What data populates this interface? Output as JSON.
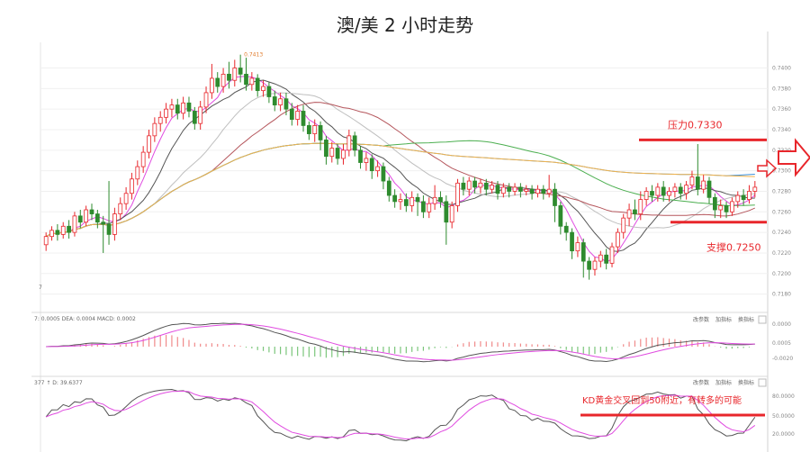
{
  "chart_data": {
    "type": "candlestick",
    "title": "澳/美 2 小时走势",
    "main": {
      "ylim": [
        0.717,
        0.7425
      ],
      "ticks": [
        "0.7400",
        "0.7380",
        "0.7360",
        "0.7340",
        "0.7320",
        "0.7300",
        "0.7280",
        "0.7260",
        "0.7240",
        "0.7220",
        "0.7200",
        "0.7180"
      ],
      "high_label": "0.7413",
      "left_label": "7",
      "candles": [
        [
          0.7228,
          0.7236,
          0.7222,
          0.724
        ],
        [
          0.7236,
          0.7242,
          0.7232,
          0.7246
        ],
        [
          0.7242,
          0.7238,
          0.7232,
          0.7248
        ],
        [
          0.7238,
          0.7246,
          0.7234,
          0.725
        ],
        [
          0.7246,
          0.724,
          0.7234,
          0.7252
        ],
        [
          0.724,
          0.7256,
          0.7236,
          0.726
        ],
        [
          0.7256,
          0.725,
          0.7244,
          0.7262
        ],
        [
          0.725,
          0.7262,
          0.7246,
          0.7266
        ],
        [
          0.7262,
          0.7258,
          0.7252,
          0.7268
        ],
        [
          0.7258,
          0.725,
          0.7244,
          0.7262
        ],
        [
          0.725,
          0.7248,
          0.722,
          0.7256
        ],
        [
          0.7248,
          0.7238,
          0.7228,
          0.729
        ],
        [
          0.7238,
          0.7258,
          0.7232,
          0.7264
        ],
        [
          0.7258,
          0.7268,
          0.7252,
          0.7274
        ],
        [
          0.7268,
          0.7278,
          0.7262,
          0.7284
        ],
        [
          0.7278,
          0.7292,
          0.7272,
          0.7298
        ],
        [
          0.7292,
          0.7304,
          0.7286,
          0.731
        ],
        [
          0.7304,
          0.7318,
          0.7298,
          0.7324
        ],
        [
          0.7318,
          0.7334,
          0.7312,
          0.734
        ],
        [
          0.7334,
          0.7346,
          0.7328,
          0.7352
        ],
        [
          0.7346,
          0.7352,
          0.7338,
          0.7358
        ],
        [
          0.7352,
          0.736,
          0.7346,
          0.7366
        ],
        [
          0.736,
          0.7364,
          0.7352,
          0.737
        ],
        [
          0.7364,
          0.7356,
          0.735,
          0.737
        ],
        [
          0.7356,
          0.7366,
          0.735,
          0.7372
        ],
        [
          0.7366,
          0.7358,
          0.7352,
          0.7372
        ],
        [
          0.7358,
          0.7346,
          0.734,
          0.7362
        ],
        [
          0.7346,
          0.7362,
          0.734,
          0.7368
        ],
        [
          0.7362,
          0.7376,
          0.7356,
          0.7382
        ],
        [
          0.7376,
          0.739,
          0.737,
          0.7404
        ],
        [
          0.739,
          0.7382,
          0.7376,
          0.7396
        ],
        [
          0.7382,
          0.7394,
          0.7376,
          0.74
        ],
        [
          0.7394,
          0.7388,
          0.738,
          0.7406
        ],
        [
          0.7388,
          0.74,
          0.7382,
          0.7408
        ],
        [
          0.74,
          0.7394,
          0.7386,
          0.7413
        ],
        [
          0.7394,
          0.7384,
          0.7378,
          0.741
        ],
        [
          0.7384,
          0.739,
          0.7378,
          0.7396
        ],
        [
          0.739,
          0.7378,
          0.7372,
          0.7394
        ],
        [
          0.7378,
          0.7382,
          0.7372,
          0.7388
        ],
        [
          0.7382,
          0.7372,
          0.7366,
          0.7386
        ],
        [
          0.7372,
          0.7364,
          0.7358,
          0.7378
        ],
        [
          0.7364,
          0.737,
          0.7358,
          0.7376
        ],
        [
          0.737,
          0.736,
          0.7354,
          0.7376
        ],
        [
          0.736,
          0.735,
          0.7344,
          0.7366
        ],
        [
          0.735,
          0.7358,
          0.7344,
          0.7364
        ],
        [
          0.7358,
          0.7344,
          0.7338,
          0.7364
        ],
        [
          0.7344,
          0.7336,
          0.733,
          0.7348
        ],
        [
          0.7336,
          0.7344,
          0.7328,
          0.735
        ],
        [
          0.7344,
          0.733,
          0.732,
          0.7348
        ],
        [
          0.733,
          0.7314,
          0.7306,
          0.7334
        ],
        [
          0.7314,
          0.7322,
          0.7308,
          0.7328
        ],
        [
          0.7322,
          0.7312,
          0.7306,
          0.7326
        ],
        [
          0.7312,
          0.732,
          0.7306,
          0.7326
        ],
        [
          0.732,
          0.7334,
          0.7314,
          0.734
        ],
        [
          0.7334,
          0.732,
          0.7314,
          0.7338
        ],
        [
          0.732,
          0.7308,
          0.7302,
          0.7324
        ],
        [
          0.7308,
          0.7312,
          0.73,
          0.7318
        ],
        [
          0.7312,
          0.73,
          0.7292,
          0.7316
        ],
        [
          0.73,
          0.7304,
          0.7294,
          0.731
        ],
        [
          0.7304,
          0.729,
          0.7282,
          0.7308
        ],
        [
          0.729,
          0.7276,
          0.727,
          0.7294
        ],
        [
          0.7276,
          0.727,
          0.7264,
          0.7282
        ],
        [
          0.727,
          0.7272,
          0.7262,
          0.7278
        ],
        [
          0.7272,
          0.7266,
          0.726,
          0.7278
        ],
        [
          0.7266,
          0.7274,
          0.726,
          0.728
        ],
        [
          0.7274,
          0.727,
          0.7256,
          0.7278
        ],
        [
          0.727,
          0.726,
          0.7254,
          0.7276
        ],
        [
          0.726,
          0.7268,
          0.7254,
          0.7274
        ],
        [
          0.7268,
          0.7274,
          0.7262,
          0.7286
        ],
        [
          0.7274,
          0.727,
          0.7264,
          0.728
        ],
        [
          0.727,
          0.725,
          0.7228,
          0.7276
        ],
        [
          0.725,
          0.7266,
          0.7244,
          0.727
        ],
        [
          0.7266,
          0.7288,
          0.726,
          0.7292
        ],
        [
          0.7288,
          0.7282,
          0.7276,
          0.7294
        ],
        [
          0.7282,
          0.729,
          0.7276,
          0.7294
        ],
        [
          0.729,
          0.7284,
          0.7278,
          0.7294
        ],
        [
          0.7284,
          0.7288,
          0.7278,
          0.7292
        ],
        [
          0.7288,
          0.7282,
          0.7276,
          0.7292
        ],
        [
          0.7282,
          0.7286,
          0.7278,
          0.729
        ],
        [
          0.7286,
          0.7278,
          0.7272,
          0.729
        ],
        [
          0.7278,
          0.7284,
          0.7274,
          0.7288
        ],
        [
          0.7284,
          0.728,
          0.7274,
          0.7288
        ],
        [
          0.728,
          0.7284,
          0.7276,
          0.7288
        ],
        [
          0.7284,
          0.728,
          0.7274,
          0.7288
        ],
        [
          0.728,
          0.7282,
          0.7276,
          0.7286
        ],
        [
          0.7282,
          0.7278,
          0.7272,
          0.7286
        ],
        [
          0.7278,
          0.7282,
          0.7274,
          0.7286
        ],
        [
          0.7282,
          0.7278,
          0.7272,
          0.7286
        ],
        [
          0.7278,
          0.7282,
          0.7274,
          0.7296
        ],
        [
          0.7282,
          0.7266,
          0.725,
          0.7288
        ],
        [
          0.7266,
          0.7246,
          0.7238,
          0.727
        ],
        [
          0.7246,
          0.724,
          0.7232,
          0.725
        ],
        [
          0.724,
          0.7222,
          0.7214,
          0.7244
        ],
        [
          0.7222,
          0.723,
          0.7216,
          0.7236
        ],
        [
          0.723,
          0.7212,
          0.7196,
          0.7234
        ],
        [
          0.7212,
          0.7204,
          0.7194,
          0.7216
        ],
        [
          0.7204,
          0.7212,
          0.7198,
          0.7216
        ],
        [
          0.7212,
          0.7218,
          0.7206,
          0.7222
        ],
        [
          0.7218,
          0.721,
          0.7204,
          0.7224
        ],
        [
          0.721,
          0.7226,
          0.7206,
          0.723
        ],
        [
          0.7226,
          0.724,
          0.722,
          0.7244
        ],
        [
          0.724,
          0.7254,
          0.7234,
          0.7258
        ],
        [
          0.7254,
          0.7262,
          0.7246,
          0.7268
        ],
        [
          0.7262,
          0.7258,
          0.7252,
          0.7272
        ],
        [
          0.7258,
          0.7272,
          0.7252,
          0.728
        ],
        [
          0.7272,
          0.728,
          0.7266,
          0.7284
        ],
        [
          0.728,
          0.7276,
          0.727,
          0.7286
        ],
        [
          0.7276,
          0.7284,
          0.727,
          0.7288
        ],
        [
          0.7284,
          0.7276,
          0.727,
          0.729
        ],
        [
          0.7276,
          0.728,
          0.727,
          0.7284
        ],
        [
          0.728,
          0.7284,
          0.7274,
          0.7288
        ],
        [
          0.7284,
          0.7278,
          0.7272,
          0.7288
        ],
        [
          0.7278,
          0.7286,
          0.7272,
          0.729
        ],
        [
          0.7286,
          0.7294,
          0.7282,
          0.73
        ],
        [
          0.7294,
          0.7282,
          0.7276,
          0.7326
        ],
        [
          0.7282,
          0.729,
          0.7278,
          0.7296
        ],
        [
          0.729,
          0.7274,
          0.7268,
          0.7294
        ],
        [
          0.7274,
          0.7262,
          0.7254,
          0.7278
        ],
        [
          0.7262,
          0.7266,
          0.7254,
          0.7272
        ],
        [
          0.7266,
          0.726,
          0.7254,
          0.727
        ],
        [
          0.726,
          0.727,
          0.7256,
          0.7274
        ],
        [
          0.727,
          0.7276,
          0.7264,
          0.728
        ],
        [
          0.7276,
          0.7272,
          0.7266,
          0.7282
        ],
        [
          0.7272,
          0.728,
          0.7268,
          0.7286
        ],
        [
          0.728,
          0.7284,
          0.7274,
          0.729
        ]
      ]
    },
    "macd": {
      "header": "7: 0.0005  DEA: 0.0004  MACD: 0.0002",
      "ticks": [
        "0.0000",
        "0.0005",
        "-0.0020"
      ]
    },
    "kd": {
      "header": "377  ↑ D: 39.6377",
      "ticks": [
        "80.0000",
        "50.0000",
        "20.0000"
      ]
    },
    "panel_controls": [
      "改参数",
      "加指标",
      "换指标",
      "×"
    ],
    "annotations": {
      "resistance": "压力0.7330",
      "support": "支撑0.7250",
      "kd_note": "KD黄金交叉回到50附近，有转多的可能"
    },
    "colors": {
      "up": "#e8262b",
      "down": "#2e8b2e",
      "annotation": "#e8262b"
    }
  }
}
